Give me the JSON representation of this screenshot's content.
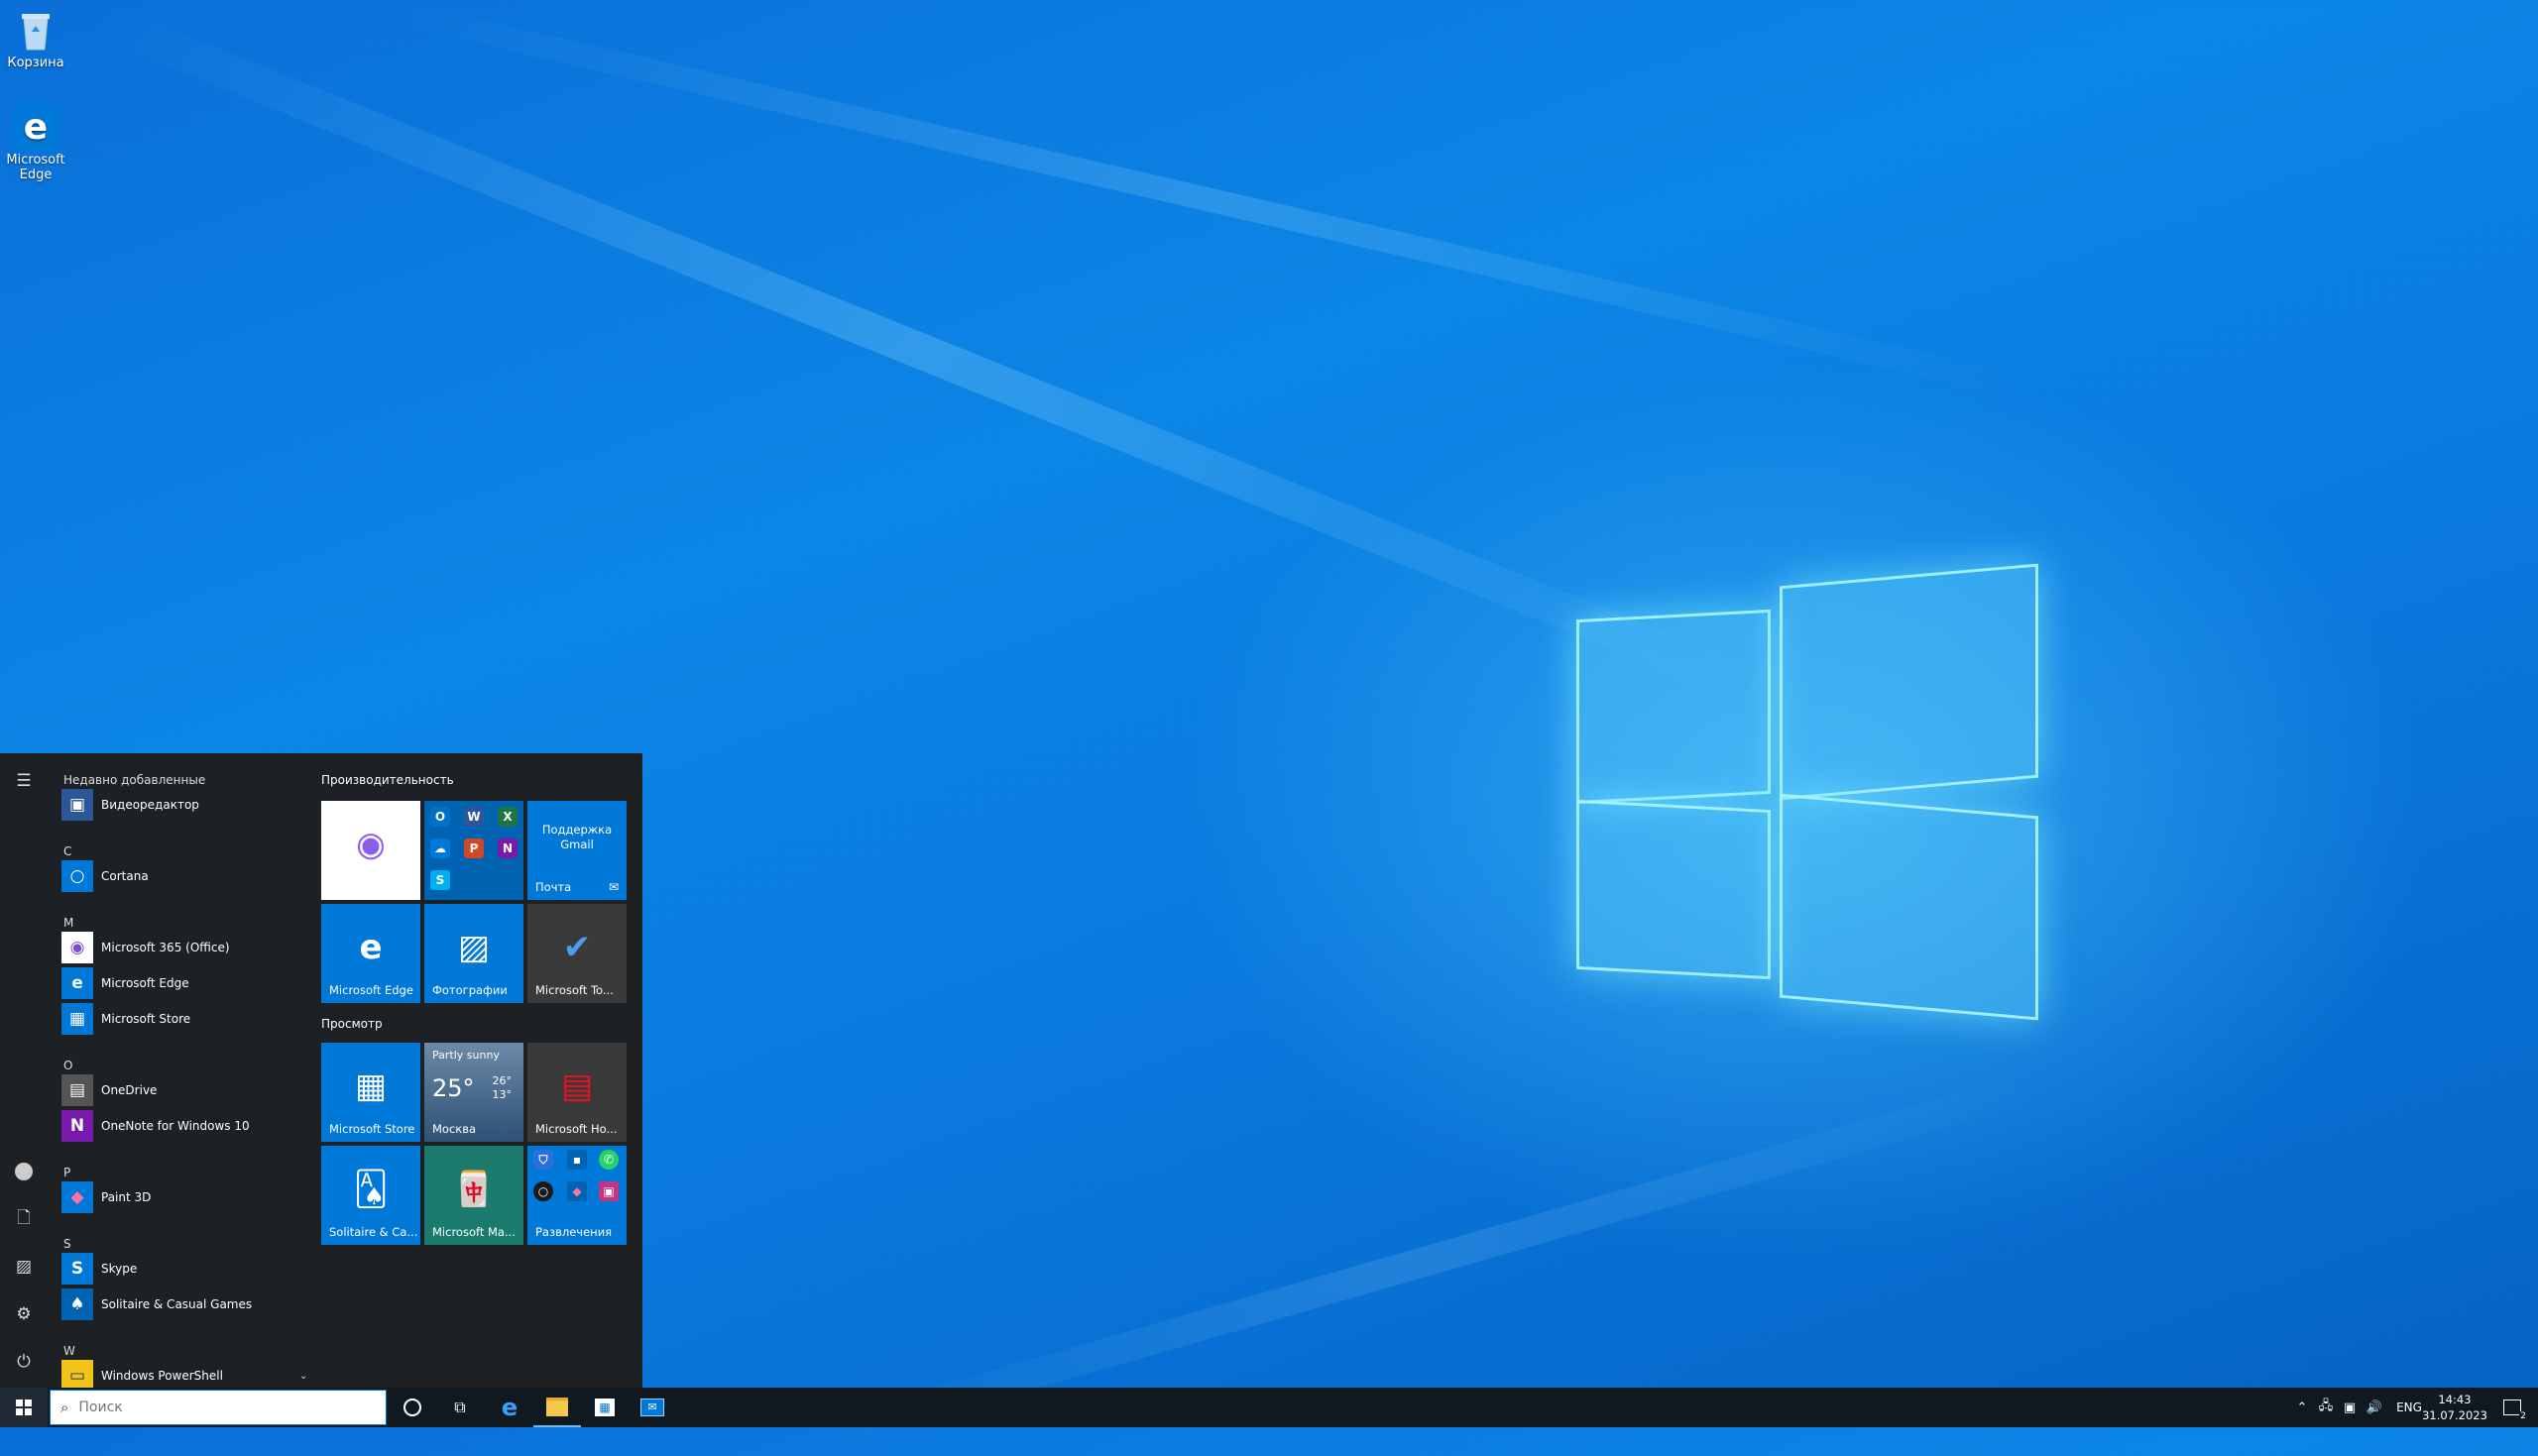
{
  "desktop": {
    "icons": [
      {
        "label": "Корзина",
        "icon": "recycle-bin-icon"
      },
      {
        "label": "Microsoft Edge",
        "icon": "edge-icon"
      }
    ]
  },
  "start_menu": {
    "rail": [
      "hamburger-icon",
      "user-icon",
      "documents-icon",
      "pictures-icon",
      "settings-icon",
      "power-icon"
    ],
    "app_list": {
      "recent_header": "Недавно добавленные",
      "recent": [
        {
          "label": "Видеоредактор",
          "color": "#2b5797"
        }
      ],
      "groups": [
        {
          "letter": "C",
          "apps": [
            {
              "label": "Cortana",
              "color": "#0078d7",
              "glyph": "○"
            }
          ]
        },
        {
          "letter": "M",
          "apps": [
            {
              "label": "Microsoft 365 (Office)",
              "color": "#ffffff",
              "glyph": "◉"
            },
            {
              "label": "Microsoft Edge",
              "color": "#0078d7",
              "glyph": "e"
            },
            {
              "label": "Microsoft Store",
              "color": "#0078d7",
              "glyph": "▦"
            }
          ]
        },
        {
          "letter": "O",
          "apps": [
            {
              "label": "OneDrive",
              "color": "#555555",
              "glyph": "▤"
            },
            {
              "label": "OneNote for Windows 10",
              "color": "#7719aa",
              "glyph": "N"
            }
          ]
        },
        {
          "letter": "P",
          "apps": [
            {
              "label": "Paint 3D",
              "color": "#0078d7",
              "glyph": "◆"
            }
          ]
        },
        {
          "letter": "S",
          "apps": [
            {
              "label": "Skype",
              "color": "#0078d7",
              "glyph": "S"
            },
            {
              "label": "Solitaire & Casual Games",
              "color": "#0063b1",
              "glyph": "♠"
            }
          ]
        },
        {
          "letter": "W",
          "apps": [
            {
              "label": "Windows PowerShell",
              "color": "#f0c419",
              "glyph": "▭"
            }
          ]
        }
      ]
    },
    "tiles": {
      "productivity_header": "Производительность",
      "productivity": [
        {
          "label": "",
          "kind": "office",
          "color": "#ffffff"
        },
        {
          "label": "",
          "kind": "office-folder",
          "color": "#0063b1"
        },
        {
          "label": "Почта",
          "kind": "mail",
          "color": "#0078d7",
          "sub": "Поддержка Gmail"
        },
        {
          "label": "Microsoft Edge",
          "kind": "edge",
          "color": "#0078d7"
        },
        {
          "label": "Фотографии",
          "kind": "photos",
          "color": "#0078d7"
        },
        {
          "label": "Microsoft To...",
          "kind": "todo",
          "color": "#3a3a3a"
        }
      ],
      "browse_header": "Просмотр",
      "browse": [
        {
          "label": "Microsoft Store",
          "kind": "store",
          "color": "#0078d7"
        },
        {
          "label": "Москва",
          "kind": "weather",
          "color": "#4a6b8a",
          "condition": "Partly sunny",
          "temp": "25°",
          "high": "26°",
          "low": "13°"
        },
        {
          "label": "Microsoft Ho...",
          "kind": "news",
          "color": "#3a3a3a"
        },
        {
          "label": "Solitaire & Ca...",
          "kind": "solitaire",
          "color": "#0078d7"
        },
        {
          "label": "Microsoft Ma...",
          "kind": "mahjong",
          "color": "#1a7a6e"
        },
        {
          "label": "Развлечения",
          "kind": "folder",
          "color": "#0078d7"
        }
      ]
    }
  },
  "taskbar": {
    "search_placeholder": "Поиск",
    "pinned": [
      "cortana-icon",
      "task-view-icon",
      "edge-icon",
      "file-explorer-icon",
      "store-icon",
      "mail-icon"
    ],
    "tray": {
      "language": "ENG",
      "time": "14:43",
      "date": "31.07.2023",
      "notifications": "2"
    }
  }
}
